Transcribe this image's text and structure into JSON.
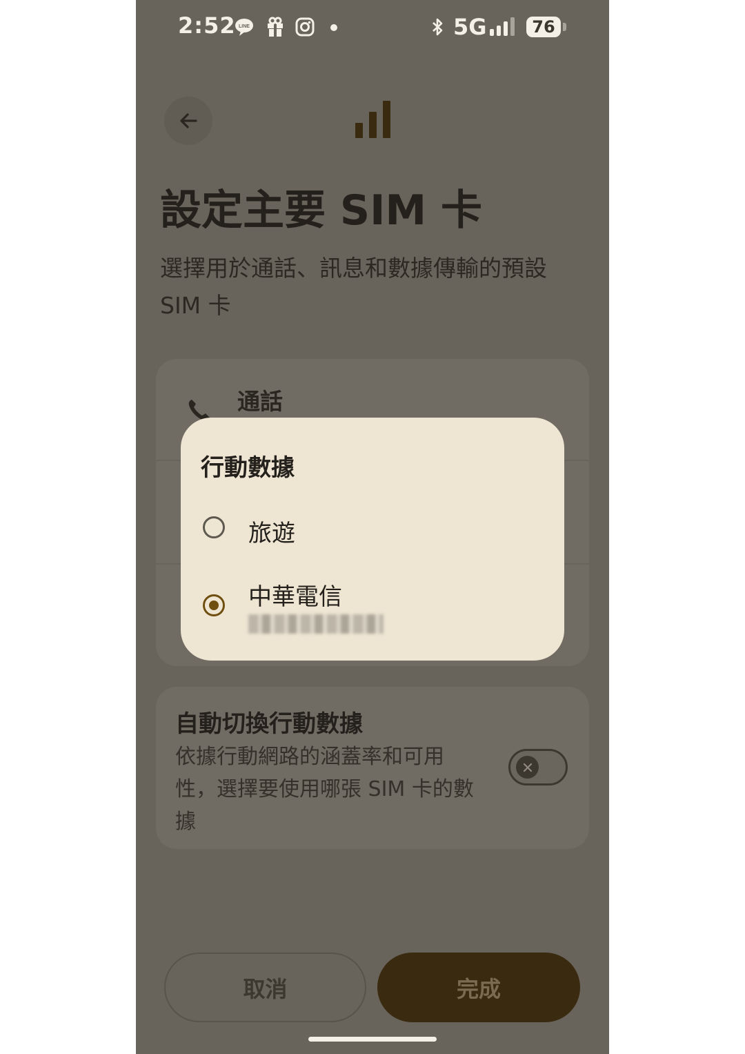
{
  "status_bar": {
    "time": "2:52",
    "network": "5G",
    "battery": "76"
  },
  "page": {
    "title": "設定主要 SIM 卡",
    "subtitle": "選擇用於通話、訊息和數據傳輸的預設 SIM 卡"
  },
  "settings": {
    "call_label": "通話"
  },
  "dialog": {
    "title": "行動數據",
    "options": [
      {
        "label": "旅遊",
        "selected": false
      },
      {
        "label": "中華電信",
        "selected": true
      }
    ]
  },
  "auto_switch": {
    "title": "自動切換行動數據",
    "description": "依據行動網路的涵蓋率和可用性，選擇要使用哪張 SIM 卡的數據",
    "enabled": false
  },
  "buttons": {
    "cancel": "取消",
    "done": "完成"
  },
  "colors": {
    "accent": "#6f4f10",
    "scrim_background": "#68645b",
    "dialog_background": "#efe5d3",
    "primary_button": "#3a2a10"
  }
}
